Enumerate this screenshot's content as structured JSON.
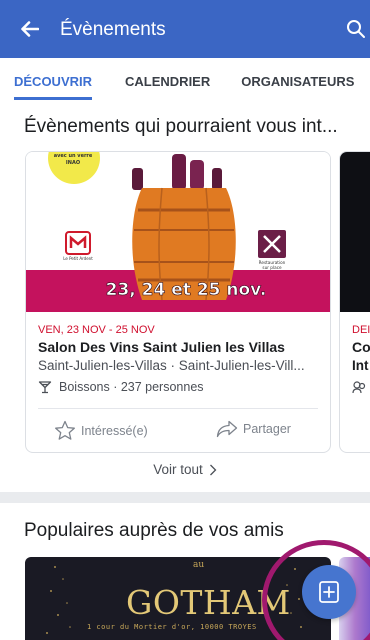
{
  "header": {
    "title": "Évènements",
    "back_icon": "arrow-left-icon",
    "search_icon": "search-icon",
    "bg_color": "#3b66c4"
  },
  "tabs": [
    {
      "label": "DÉCOUVRIR",
      "active": true
    },
    {
      "label": "CALENDRIER",
      "active": false
    },
    {
      "label": "ORGANISATEURS",
      "active": false
    }
  ],
  "sections": {
    "suggested_title": "Évènements qui pourraient vous int...",
    "popular_title": "Populaires auprès de vos amis",
    "see_all": "Voir tout"
  },
  "event_card": {
    "poster": {
      "badge": "avec un verre INAO",
      "dates_banner": "23, 24 et 25 nov.",
      "logo_text": "Le Petit Ardent",
      "food_label": "Restauration sur place"
    },
    "date": "VEN, 23 NOV - 25 NOV",
    "name": "Salon Des Vins Saint Julien les Villas",
    "location": "Saint-Julien-les-Villas · Saint-Julien-les-Vill...",
    "category": "Boissons · 237 personnes",
    "interested_label": "Intéressé(e)",
    "share_label": "Partager"
  },
  "event_card_2": {
    "date": "DEI",
    "line1": "Co",
    "line2": "Int"
  },
  "popular_card": {
    "prefix": "au",
    "name": "GOTHAM",
    "address": "1 cour du Mortier d'or, 10000 TROYES"
  },
  "fab": {
    "icon": "create-event-icon",
    "color": "#4675cf",
    "highlight_color": "#a0196e"
  }
}
